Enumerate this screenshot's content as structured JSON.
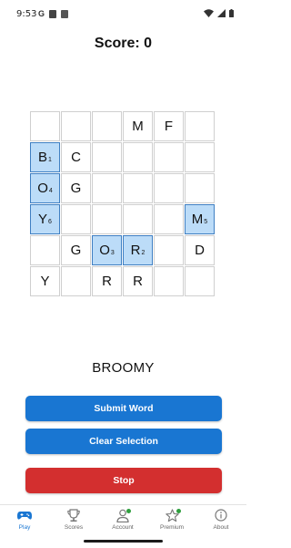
{
  "status_bar": {
    "time": "9:53",
    "icon_g": "G"
  },
  "score_label": "Score: 0",
  "grid": [
    [
      {
        "letter": "",
        "order": ""
      },
      {
        "letter": "",
        "order": ""
      },
      {
        "letter": "",
        "order": ""
      },
      {
        "letter": "M",
        "order": ""
      },
      {
        "letter": "F",
        "order": ""
      },
      {
        "letter": "",
        "order": ""
      }
    ],
    [
      {
        "letter": "B",
        "order": "1",
        "selected": true
      },
      {
        "letter": "C",
        "order": ""
      },
      {
        "letter": "",
        "order": ""
      },
      {
        "letter": "",
        "order": ""
      },
      {
        "letter": "",
        "order": ""
      },
      {
        "letter": "",
        "order": ""
      }
    ],
    [
      {
        "letter": "O",
        "order": "4",
        "selected": true
      },
      {
        "letter": "G",
        "order": ""
      },
      {
        "letter": "",
        "order": ""
      },
      {
        "letter": "",
        "order": ""
      },
      {
        "letter": "",
        "order": ""
      },
      {
        "letter": "",
        "order": ""
      }
    ],
    [
      {
        "letter": "Y",
        "order": "6",
        "selected": true
      },
      {
        "letter": "",
        "order": ""
      },
      {
        "letter": "",
        "order": ""
      },
      {
        "letter": "",
        "order": ""
      },
      {
        "letter": "",
        "order": ""
      },
      {
        "letter": "M",
        "order": "5",
        "selected": true
      }
    ],
    [
      {
        "letter": "",
        "order": ""
      },
      {
        "letter": "G",
        "order": ""
      },
      {
        "letter": "O",
        "order": "3",
        "selected": true
      },
      {
        "letter": "R",
        "order": "2",
        "selected": true
      },
      {
        "letter": "",
        "order": ""
      },
      {
        "letter": "D",
        "order": ""
      }
    ],
    [
      {
        "letter": "Y",
        "order": ""
      },
      {
        "letter": "",
        "order": ""
      },
      {
        "letter": "R",
        "order": ""
      },
      {
        "letter": "R",
        "order": ""
      },
      {
        "letter": "",
        "order": ""
      },
      {
        "letter": "",
        "order": ""
      }
    ]
  ],
  "current_word": "BROOMY",
  "buttons": {
    "submit": "Submit Word",
    "clear": "Clear Selection",
    "stop": "Stop"
  },
  "nav": [
    {
      "label": "Play",
      "icon": "gamepad-icon",
      "active": true
    },
    {
      "label": "Scores",
      "icon": "trophy-icon"
    },
    {
      "label": "Account",
      "icon": "person-icon",
      "badge": true
    },
    {
      "label": "Premium",
      "icon": "star-icon",
      "badge": true
    },
    {
      "label": "About",
      "icon": "info-icon"
    }
  ],
  "colors": {
    "primary": "#1976d2",
    "danger": "#d32f2f",
    "selected_cell": "#bcdcf8",
    "badge": "#2e9e3e"
  }
}
